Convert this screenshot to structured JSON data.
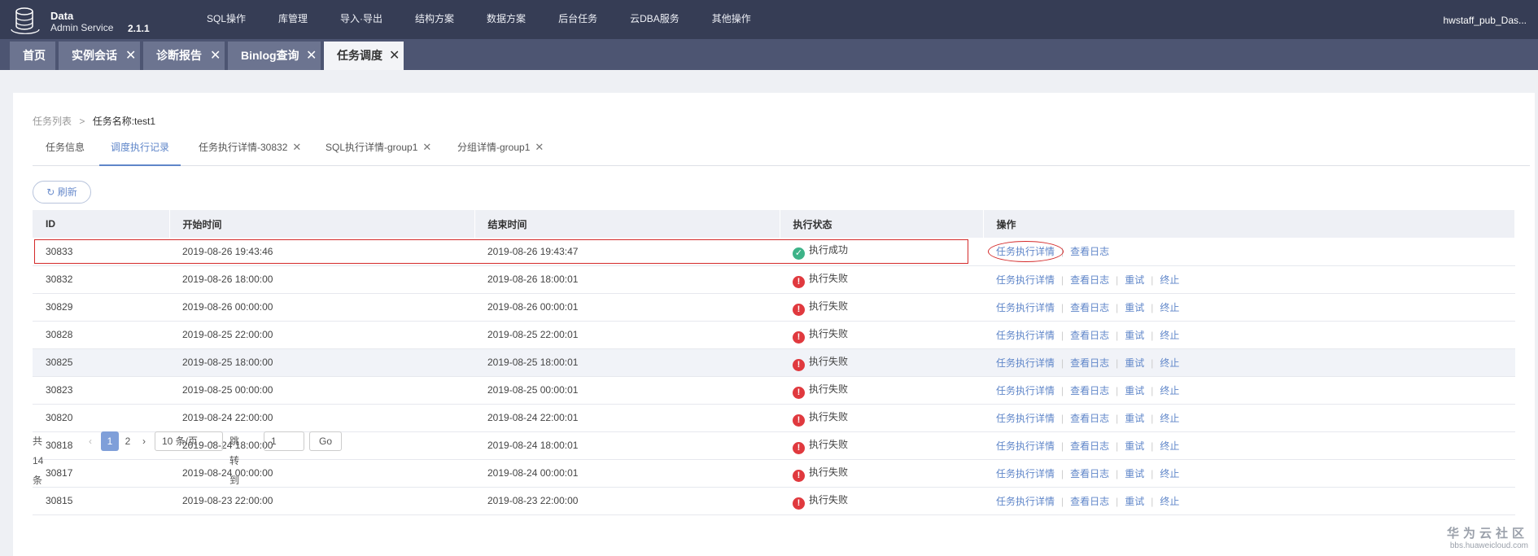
{
  "logo": {
    "title": "Data",
    "sub": "Admin Service",
    "version": "2.1.1"
  },
  "nav": [
    "SQL操作",
    "库管理",
    "导入·导出",
    "结构方案",
    "数据方案",
    "后台任务",
    "云DBA服务",
    "其他操作"
  ],
  "user": "hwstaff_pub_Das...",
  "page_tabs": [
    {
      "label": "首页",
      "closable": false
    },
    {
      "label": "实例会话",
      "closable": true
    },
    {
      "label": "诊断报告",
      "closable": true
    },
    {
      "label": "Binlog查询",
      "closable": true
    },
    {
      "label": "任务调度",
      "closable": true,
      "active": true
    }
  ],
  "breadcrumb": {
    "parent": "任务列表",
    "separator": ">",
    "current": "任务名称:test1"
  },
  "sub_tabs": [
    {
      "label": "任务信息"
    },
    {
      "label": "调度执行记录",
      "active": true
    },
    {
      "label": "任务执行详情-30832",
      "closable": true
    },
    {
      "label": "SQL执行详情-group1",
      "closable": true
    },
    {
      "label": "分组详情-group1",
      "closable": true
    }
  ],
  "refresh_label": "刷新",
  "table": {
    "columns": [
      "ID",
      "开始时间",
      "结束时间",
      "执行状态",
      "操作"
    ],
    "rows": [
      {
        "id": "30833",
        "start": "2019-08-26 19:43:46",
        "end": "2019-08-26 19:43:47",
        "status": "执行成功",
        "ok": true
      },
      {
        "id": "30832",
        "start": "2019-08-26 18:00:00",
        "end": "2019-08-26 18:00:01",
        "status": "执行失败",
        "ok": false
      },
      {
        "id": "30829",
        "start": "2019-08-26 00:00:00",
        "end": "2019-08-26 00:00:01",
        "status": "执行失败",
        "ok": false
      },
      {
        "id": "30828",
        "start": "2019-08-25 22:00:00",
        "end": "2019-08-25 22:00:01",
        "status": "执行失败",
        "ok": false
      },
      {
        "id": "30825",
        "start": "2019-08-25 18:00:00",
        "end": "2019-08-25 18:00:01",
        "status": "执行失败",
        "ok": false,
        "highlight": true
      },
      {
        "id": "30823",
        "start": "2019-08-25 00:00:00",
        "end": "2019-08-25 00:00:01",
        "status": "执行失败",
        "ok": false
      },
      {
        "id": "30820",
        "start": "2019-08-24 22:00:00",
        "end": "2019-08-24 22:00:01",
        "status": "执行失败",
        "ok": false
      },
      {
        "id": "30818",
        "start": "2019-08-24 18:00:00",
        "end": "2019-08-24 18:00:01",
        "status": "执行失败",
        "ok": false
      },
      {
        "id": "30817",
        "start": "2019-08-24 00:00:00",
        "end": "2019-08-24 00:00:01",
        "status": "执行失败",
        "ok": false
      },
      {
        "id": "30815",
        "start": "2019-08-23 22:00:00",
        "end": "2019-08-23 22:00:00",
        "status": "执行失败",
        "ok": false
      }
    ],
    "actions": {
      "detail": "任务执行详情",
      "log": "查看日志",
      "retry": "重试",
      "stop": "终止"
    }
  },
  "pager": {
    "total": "共 14 条",
    "pages": [
      "1",
      "2"
    ],
    "current_page": "1",
    "page_size": "10 条/页",
    "jump_label": "跳转到",
    "jump_value": "1",
    "go_label": "Go"
  },
  "watermark": {
    "brand": "华为云社区",
    "url": "bbs.huaweicloud.com"
  },
  "colors": {
    "nav_bg": "#363d55",
    "accent": "#5f86c9",
    "success": "#3db388",
    "fail": "#e0393e",
    "annotation": "#d42a2a"
  }
}
